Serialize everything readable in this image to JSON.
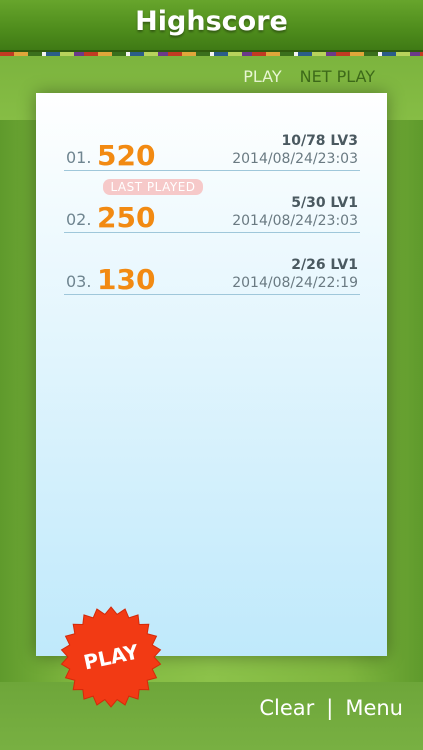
{
  "header": {
    "title": "Highscore"
  },
  "tabs": [
    {
      "label": "PLAY",
      "active": true
    },
    {
      "label": "NET PLAY",
      "active": false
    }
  ],
  "scores": [
    {
      "rank": "01.",
      "score": "520",
      "progress": "10/78  LV3",
      "date": "2014/08/24/23:03"
    },
    {
      "rank": "02.",
      "score": "250",
      "progress": "5/30  LV1",
      "date": "2014/08/24/23:03"
    },
    {
      "rank": "03.",
      "score": "130",
      "progress": "2/26  LV1",
      "date": "2014/08/24/22:19"
    }
  ],
  "last_played_label": "LAST PLAYED",
  "play_button_label": "PLAY",
  "footer": {
    "clear_label": "Clear",
    "separator": "|",
    "menu_label": "Menu"
  },
  "colors": {
    "header_green": "#4e8c1c",
    "score_orange": "#f28a12",
    "play_badge_red": "#f23a14",
    "badge_pink": "#f6c9c9"
  }
}
